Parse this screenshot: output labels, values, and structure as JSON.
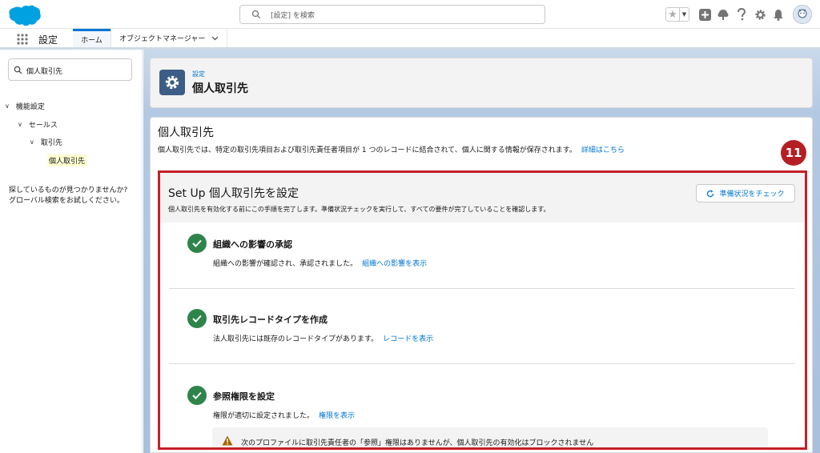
{
  "header": {
    "search_placeholder": "[設定] を検索"
  },
  "context_bar": {
    "app_name": "設定",
    "tabs": [
      {
        "label": "ホーム"
      },
      {
        "label": "オブジェクトマネージャー"
      }
    ]
  },
  "left_panel": {
    "quickfind_value": "個人取引先",
    "tree": [
      {
        "label": "機能設定"
      },
      {
        "label": "セールス"
      },
      {
        "label": "取引先"
      },
      {
        "label": "個人取引先"
      }
    ],
    "help_line1": "探しているものが見つかりませんか?",
    "help_line2": "グローバル検索をお試しください。"
  },
  "page_header": {
    "breadcrumb": "設定",
    "title": "個人取引先"
  },
  "content": {
    "title": "個人取引先",
    "description": "個人取引先では、特定の取引先項目および取引先責任者項目が 1 つのレコードに結合されて、個人に関する情報が保存されます。",
    "learn_more": "詳細はこちら"
  },
  "step_badge": "11",
  "setup": {
    "title": "Set Up 個人取引先を設定",
    "description": "個人取引先を有効化する前にこの手順を完了します。準備状況チェックを実行して、すべての要件が完了していることを確認します。",
    "check_button": "準備状況をチェック",
    "steps": [
      {
        "title": "組織への影響の承認",
        "desc": "組織への影響が確認され、承認されました。",
        "link": "組織への影響を表示"
      },
      {
        "title": "取引先レコードタイプを作成",
        "desc": "法人取引先には既存のレコードタイプがあります。",
        "link": "レコードを表示"
      },
      {
        "title": "参照権限を設定",
        "desc": "権限が適切に設定されました。",
        "link": "権限を表示"
      }
    ],
    "warning": "次のプロファイルに取引先責任者の「参照」権限はありませんが、個人取引先の有効化はブロックされません"
  },
  "colors": {
    "brand_blue": "#0176d3",
    "success_green": "#2e844a",
    "highlight_red": "#c62027",
    "header_badge": "#3c5d85"
  }
}
